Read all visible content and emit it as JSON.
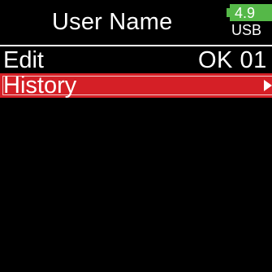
{
  "screen": {
    "title": "User Name",
    "battery": {
      "voltage": "4.9",
      "source": "USB",
      "icon": "battery-icon",
      "color": "#55b848"
    }
  },
  "menu": {
    "items": [
      {
        "label": "Edit",
        "value": "OK 01",
        "selected": false
      },
      {
        "label": "History",
        "value": "",
        "selected": true,
        "icon": "chevron-right-icon",
        "highlight_color": "#d51f26"
      }
    ]
  }
}
